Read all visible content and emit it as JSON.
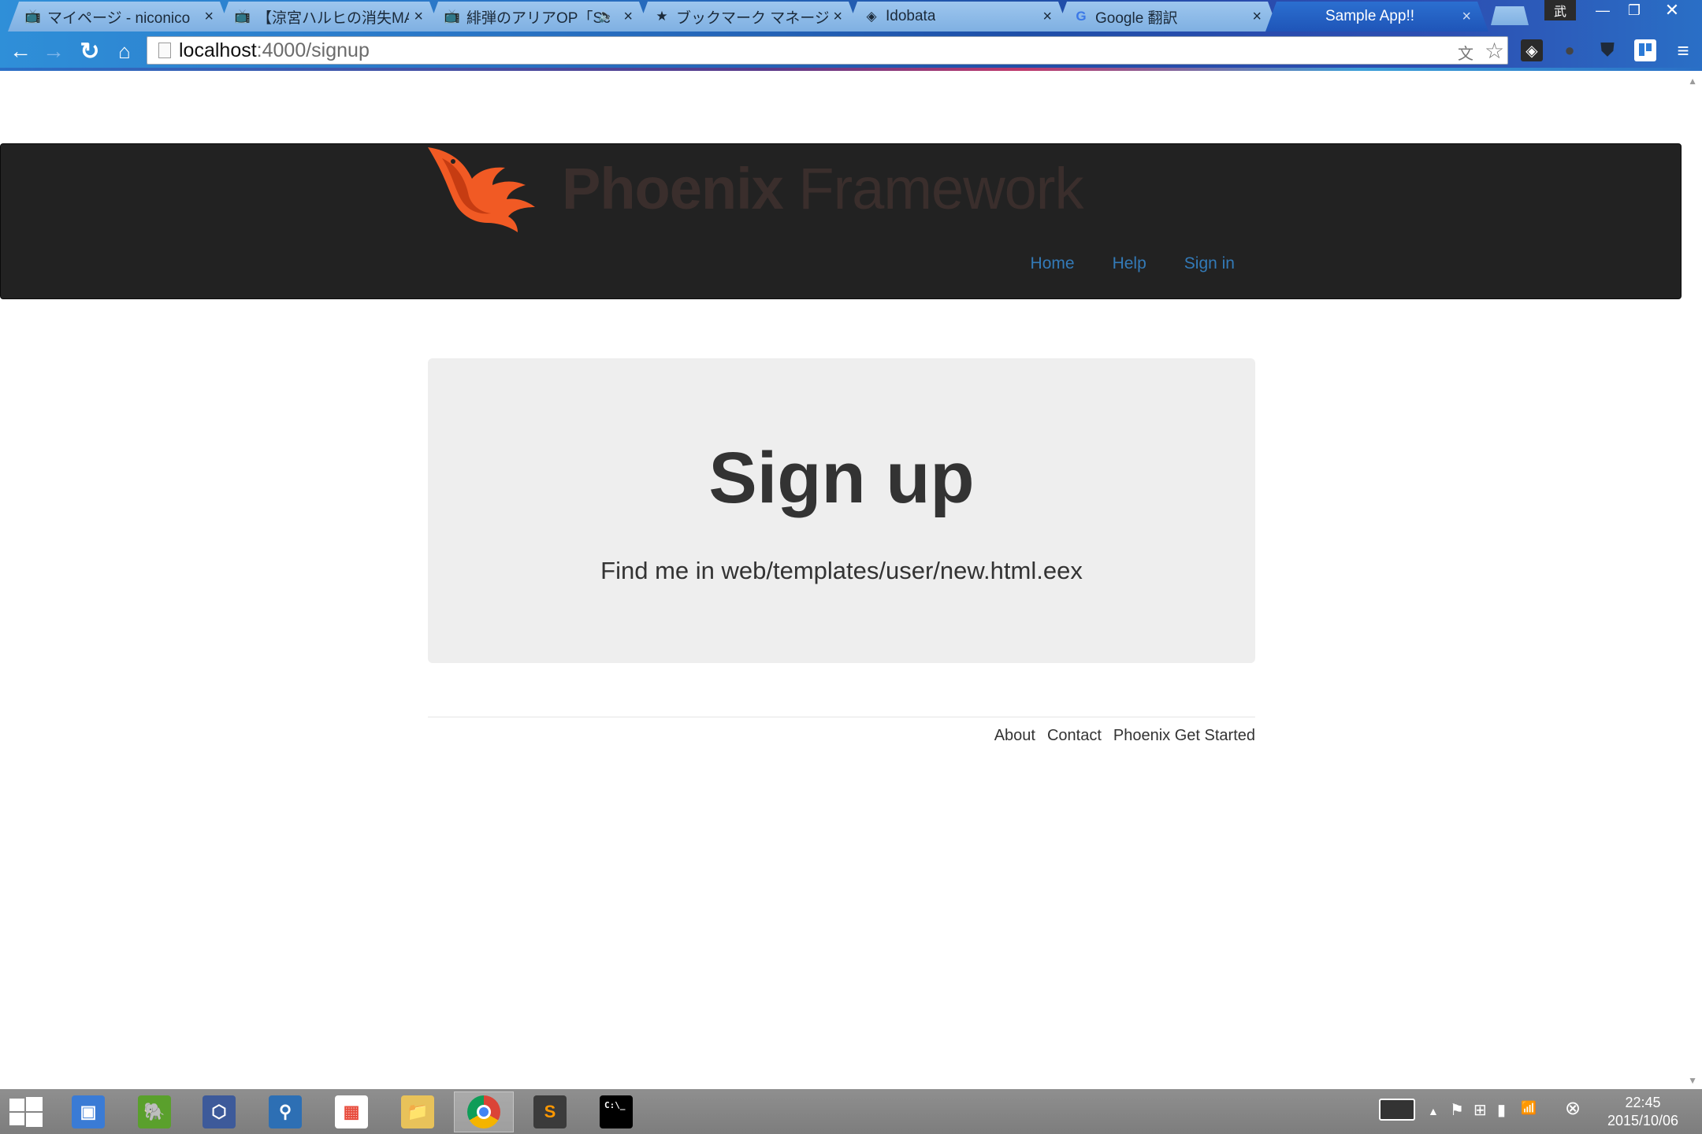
{
  "browser": {
    "tabs": [
      {
        "label": "マイページ - niconico",
        "icon": "niconico-tv-icon",
        "glyph": "📺"
      },
      {
        "label": "【涼宮ハルヒの消失MAD】",
        "icon": "niconico-tv-icon",
        "glyph": "📺"
      },
      {
        "label": "緋弾のアリアOP「Sc",
        "icon": "niconico-tv-icon",
        "glyph": "📺",
        "audio": "🔈"
      },
      {
        "label": "ブックマーク マネージャ",
        "icon": "star-icon",
        "glyph": "★"
      },
      {
        "label": "Idobata",
        "icon": "idobata-icon",
        "glyph": "◈"
      },
      {
        "label": "Google 翻訳",
        "icon": "google-translate-icon",
        "glyph": "G"
      },
      {
        "label": "Sample App!!",
        "icon": "",
        "glyph": "",
        "active": true
      }
    ],
    "tab_close_glyph": "×",
    "ime_label": "武",
    "window_controls": {
      "minimize": "—",
      "maximize": "❐",
      "close": "✕"
    },
    "address": {
      "host": "localhost",
      "path": ":4000/signup"
    },
    "nav_glyphs": {
      "back": "←",
      "forward": "→",
      "reload": "↻",
      "home": "⌂",
      "star": "☆",
      "menu": "≡",
      "translate": "文",
      "idobata": "◈",
      "dark": "●",
      "shield": "⛊"
    }
  },
  "page": {
    "logo": {
      "bold": "Phoenix",
      "light": " Framework"
    },
    "nav": [
      {
        "label": "Home"
      },
      {
        "label": "Help"
      },
      {
        "label": "Sign in"
      }
    ],
    "jumbotron": {
      "title": "Sign up",
      "subtitle": "Find me in web/templates/user/new.html.eex"
    },
    "footer": {
      "links": [
        {
          "label": "About"
        },
        {
          "label": "Contact"
        },
        {
          "label": "Phoenix Get Started"
        }
      ]
    },
    "colors": {
      "header_bg": "#222222",
      "link": "#337ab7",
      "jumbotron_bg": "#eeeeee",
      "phoenix_orange": "#f15a24"
    }
  },
  "taskbar": {
    "apps": [
      {
        "name": "remote-desktop",
        "glyph": "▣",
        "color": "#3a7bd5"
      },
      {
        "name": "evernote",
        "glyph": "🐘",
        "color": "#5aa02c"
      },
      {
        "name": "virtualbox",
        "glyph": "⬡",
        "color": "#3d5a9a"
      },
      {
        "name": "sourcetree",
        "glyph": "⚲",
        "color": "#2d6fb4"
      },
      {
        "name": "apps-grid",
        "glyph": "▦",
        "color": "#ffffff"
      },
      {
        "name": "file-explorer",
        "glyph": "📁",
        "color": "#e8c25a"
      },
      {
        "name": "chrome",
        "glyph": "◉",
        "color": "#db4437",
        "active": true
      },
      {
        "name": "sublime-text",
        "glyph": "S",
        "color": "#3b3b3b"
      },
      {
        "name": "command-prompt",
        "glyph": "C:\\_",
        "color": "#000000"
      }
    ],
    "tray_glyphs": {
      "arrow": "▲",
      "flag": "⚑",
      "windows": "⊞",
      "battery": "▮",
      "signal": "📶",
      "stop": "⊗"
    },
    "clock": {
      "time": "22:45",
      "date": "2015/10/06"
    }
  }
}
